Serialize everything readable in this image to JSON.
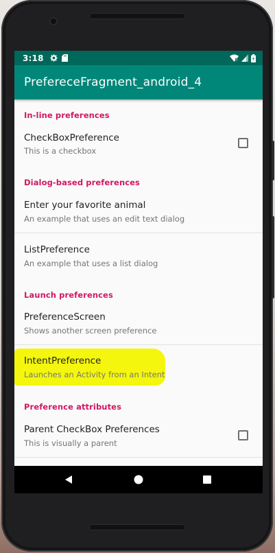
{
  "status_bar": {
    "time": "3:18",
    "left_icons": [
      "gear-icon",
      "sd-card-icon"
    ],
    "right_icons": [
      "wifi-icon",
      "signal-icon",
      "battery-icon"
    ]
  },
  "app_bar": {
    "title": "PrefereceFragment_android_4",
    "color": "#00877a",
    "status_color": "#00685a"
  },
  "preferences": {
    "inline_category": "In-line preferences",
    "checkbox_pref": {
      "title": "CheckBoxPreference",
      "summary": "This is a checkbox",
      "checked": false
    },
    "dialog_category": "Dialog-based preferences",
    "edit_text_pref": {
      "title": "Enter your favorite animal",
      "summary": "An example that uses an edit text dialog"
    },
    "list_pref": {
      "title": "ListPreference",
      "summary": "An example that uses a list dialog"
    },
    "launch_category": "Launch preferences",
    "screen_pref": {
      "title": "PreferenceScreen",
      "summary": "Shows another screen preference"
    },
    "intent_pref": {
      "title": "IntentPreference",
      "summary": "Launches an Activity from an Intent",
      "highlighted": true
    },
    "attributes_category": "Preference attributes",
    "parent_checkbox_pref": {
      "title": "Parent CheckBox Preferences",
      "summary": "This is visually a parent",
      "checked": false
    }
  },
  "nav_bar": {
    "buttons": [
      "back-icon",
      "home-icon",
      "recents-icon"
    ]
  },
  "colors": {
    "accent": "#d1185e",
    "highlight": "#f3f700"
  }
}
